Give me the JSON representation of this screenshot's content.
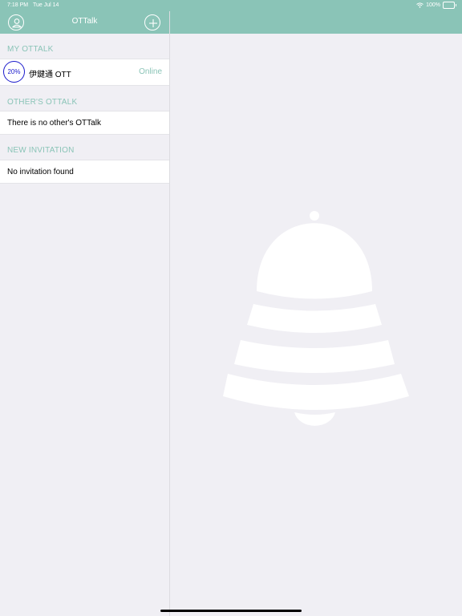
{
  "status_bar": {
    "time": "7:18 PM",
    "date": "Tue Jul 14",
    "battery": "100%",
    "wifi_icon": "wifi-icon",
    "battery_icon": "battery-icon"
  },
  "nav": {
    "title": "OTTalk",
    "left_icon": "person-icon",
    "right_icon": "plus-icon"
  },
  "sections": {
    "my": {
      "header": "MY OTTALK",
      "device": {
        "progress": "20%",
        "progress_value": 0.2,
        "name": "伊鍵通 OTT",
        "status": "Online"
      }
    },
    "others": {
      "header": "OTHER'S OTTALK",
      "empty_text": "There is no other's OTTalk"
    },
    "invitation": {
      "header": "NEW INVITATION",
      "empty_text": "No invitation found"
    }
  },
  "detail": {
    "placeholder_icon": "bell-icon"
  },
  "colors": {
    "accent": "#8ac4b7",
    "background": "#f0eff4",
    "progress": "#1a1acc",
    "cell": "#ffffff"
  }
}
